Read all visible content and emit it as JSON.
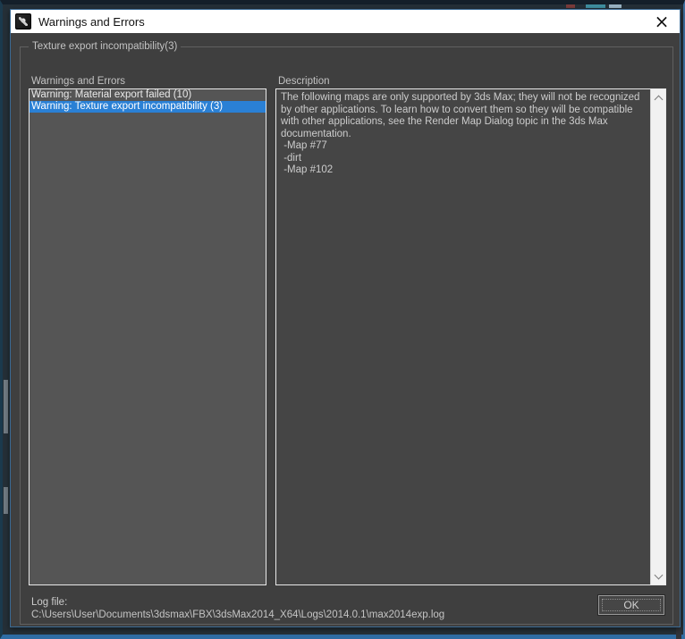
{
  "window": {
    "title": "Warnings and Errors",
    "close_glyph": "×"
  },
  "groupbox": {
    "title": "Texture export incompatibility(3)"
  },
  "warnings_panel": {
    "label": "Warnings and Errors",
    "items": [
      {
        "label": "Warning: Material export failed (10)",
        "selected": false
      },
      {
        "label": "Warning: Texture export incompatibility (3)",
        "selected": true
      }
    ]
  },
  "description_panel": {
    "label": "Description",
    "text": "The following maps are only supported by 3ds Max; they will not be recognized by other applications. To learn how to convert them so they will be compatible with other applications, see the Render Map Dialog topic in the 3ds Max documentation.",
    "map_list": [
      " -Map #77",
      " -dirt",
      " -Map #102"
    ]
  },
  "footer": {
    "log_label": "Log file:",
    "log_path": "C:\\Users\\User\\Documents\\3dsmax\\FBX\\3dsMax2014_X64\\Logs\\2014.0.1\\max2014exp.log",
    "ok_label": "OK"
  },
  "colors": {
    "selection": "#2a80d5",
    "titlebar_bg": "#ffffff",
    "dialog_bg": "#3f3f3f",
    "list_bg": "#555555",
    "desc_bg": "#454545",
    "desktop_accent": "#2f6da5"
  }
}
